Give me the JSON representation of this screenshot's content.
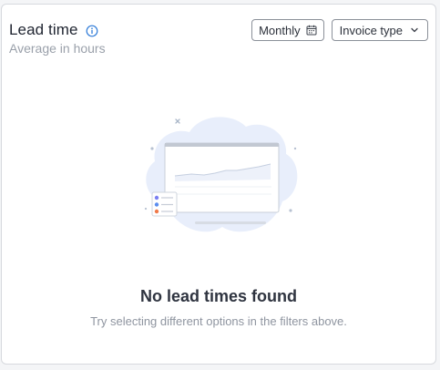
{
  "widget": {
    "title": "Lead time",
    "subtitle": "Average in hours",
    "info_icon": "info-circle-icon"
  },
  "filters": {
    "period_label": "Monthly",
    "period_icon": "calendar-icon",
    "type_label": "Invoice type",
    "type_icon": "chevron-down-icon"
  },
  "empty_state": {
    "title": "No lead times found",
    "message": "Try selecting different options in the filters above."
  },
  "colors": {
    "accent": "#2f7bd8",
    "title_text": "#1f2430",
    "muted_text": "#9aa0aa",
    "border": "#d7d9de"
  }
}
